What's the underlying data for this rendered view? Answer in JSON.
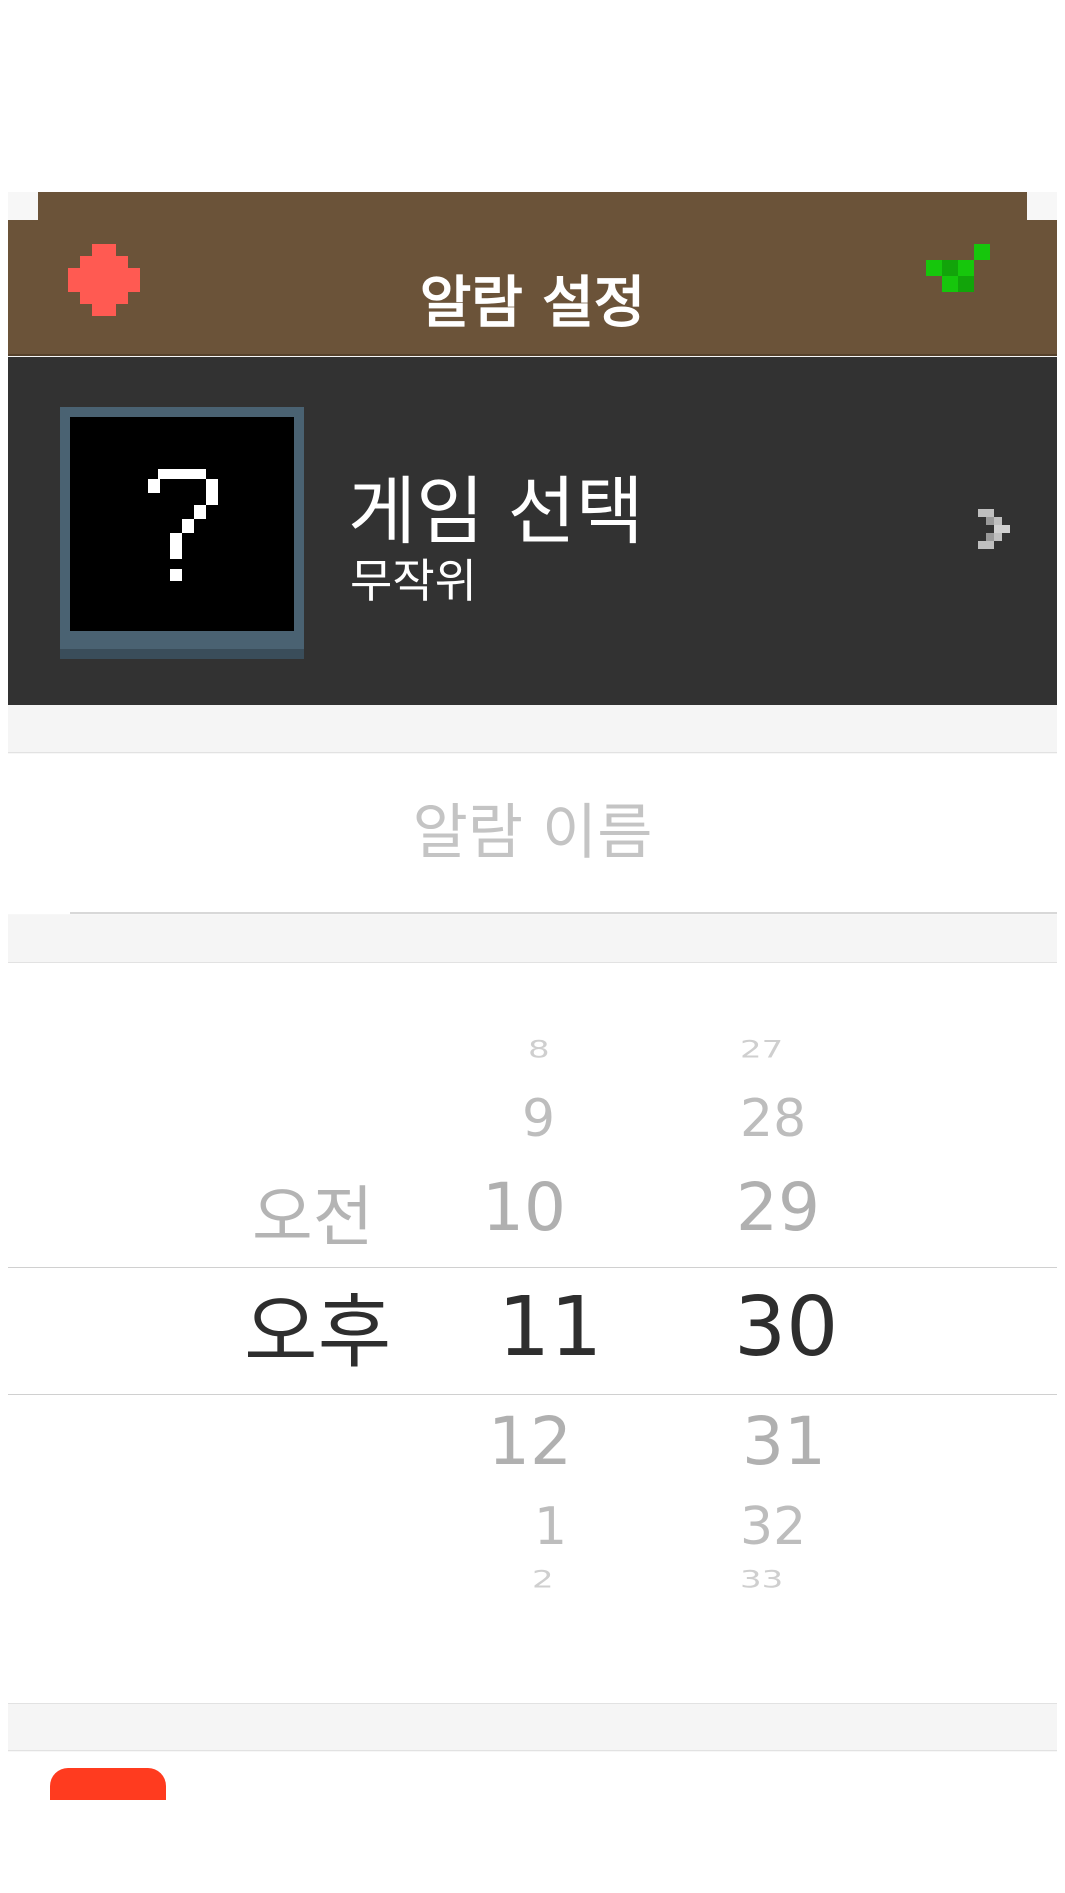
{
  "header": {
    "title": "알람 설정",
    "close_icon": "close-icon",
    "confirm_icon": "check-icon",
    "colors": {
      "bar": "#6b5339",
      "close": "#ff5a52",
      "confirm": "#16c60c"
    }
  },
  "game_select": {
    "thumbnail_glyph": "?",
    "title": "게임 선택",
    "subtitle": "무작위",
    "chevron_icon": "chevron-right-icon"
  },
  "alarm_name": {
    "placeholder": "알람 이름"
  },
  "time_picker": {
    "ampm": {
      "options": [
        "오전",
        "오후"
      ],
      "selected": "오후"
    },
    "hour": {
      "visible": [
        "8",
        "9",
        "10",
        "11",
        "12",
        "1",
        "2"
      ],
      "selected": "11"
    },
    "minute": {
      "visible": [
        "27",
        "28",
        "29",
        "30",
        "31",
        "32",
        "33"
      ],
      "selected": "30"
    }
  }
}
